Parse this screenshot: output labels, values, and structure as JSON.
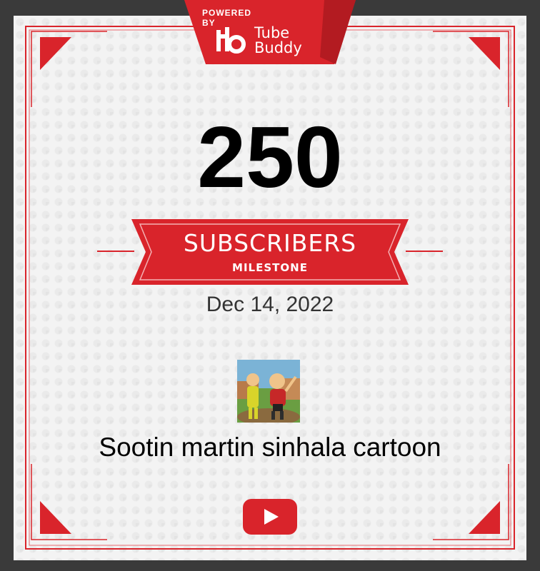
{
  "badge": {
    "powered_by": "POWERED BY",
    "logo_mark": "tb",
    "brand_line1": "Tube",
    "brand_line2": "Buddy"
  },
  "milestone": {
    "count": "250",
    "title": "SUBSCRIBERS",
    "subtitle": "MILESTONE"
  },
  "date": "Dec 14, 2022",
  "channel": {
    "name": "Sootin martin sinhala cartoon",
    "avatar_icon": "cartoon-characters-avatar"
  },
  "icons": {
    "platform": "youtube-play-icon"
  },
  "colors": {
    "accent": "#d9242b",
    "accent_dark": "#b31b21",
    "background": "#3a3a3a",
    "card": "#f3f3f3"
  }
}
